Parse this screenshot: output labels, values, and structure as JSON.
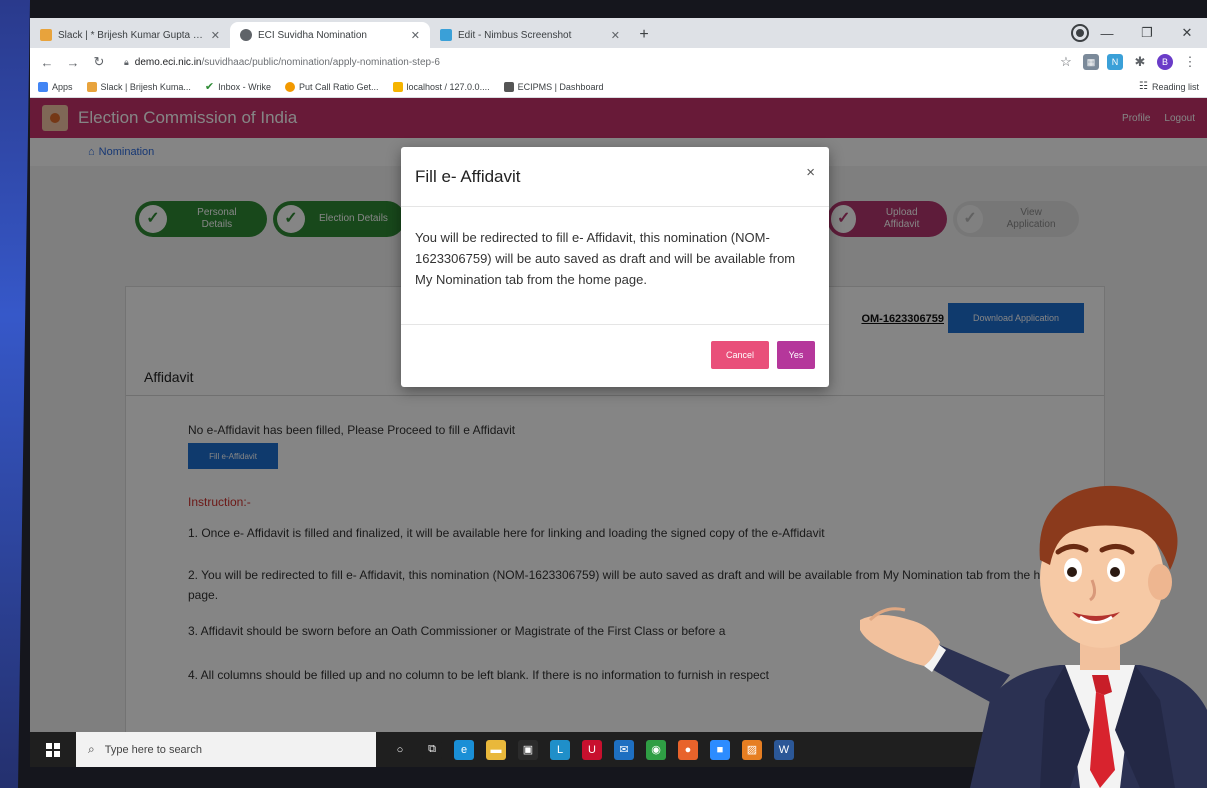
{
  "browser": {
    "tabs": [
      {
        "label": "Slack | * Brijesh Kumar Gupta | ECI",
        "favicon_color": "#e8a33c"
      },
      {
        "label": "ECI Suvidha Nomination",
        "favicon_color": "#5f6368"
      },
      {
        "label": "Edit - Nimbus Screenshot",
        "favicon_color": "#3aa0d8"
      }
    ],
    "new_tab": "+",
    "url_host": "demo.eci.nic.in",
    "url_path": "/suvidhaac/public/nomination/apply-nomination-step-6",
    "bookmarks": [
      {
        "label": "Apps",
        "color": "#4285f4"
      },
      {
        "label": "Slack | Brijesh Kuma...",
        "color": "#e8a33c"
      },
      {
        "label": "Inbox - Wrike",
        "color": "#2e8b34"
      },
      {
        "label": "Put Call Ratio Get...",
        "color": "#f29900"
      },
      {
        "label": "localhost / 127.0.0....",
        "color": "#f5b400"
      },
      {
        "label": "ECIPMS | Dashboard",
        "color": "#555555"
      }
    ],
    "reading_list": "Reading list",
    "profile_initial": "B"
  },
  "app": {
    "title": "Election Commission of India",
    "links": [
      "Profile",
      "Logout"
    ],
    "breadcrumb": "Nomination",
    "steps": [
      {
        "label": "Personal Details",
        "state": "done"
      },
      {
        "label": "Election Details",
        "state": "done"
      },
      {
        "label": "Upload Affidavit",
        "state": "current"
      },
      {
        "label": "View Application",
        "state": "pending"
      }
    ],
    "application_no": "OM-1623306759",
    "download_button": "Download Application",
    "affidavit_heading": "Affidavit",
    "no_affidavit_text": "No e-Affidavit has been filled, Please Proceed to fill e Affidavit",
    "fill_button": "Fill e-Affidavit",
    "instruction_heading": "Instruction:-",
    "instructions": [
      "1. Once e- Affidavit is filled and finalized, it will be available here for linking and loading the signed copy of the e-Affidavit",
      "2. You will be redirected to fill e- Affidavit, this nomination (NOM-1623306759) will be auto saved as draft and will be available from My Nomination tab from the home page.",
      "3. Affidavit should be sworn before an Oath Commissioner or Magistrate of the First Class or before a",
      "4. All columns should be filled up and no column to be left blank. If there is no information to furnish in respect"
    ]
  },
  "modal": {
    "title": "Fill e- Affidavit",
    "close": "×",
    "body": "You will be redirected to fill e- Affidavit, this nomination (NOM-1623306759) will be auto saved as draft and will be available from My Nomination tab from the home page.",
    "cancel": "Cancel",
    "yes": "Yes"
  },
  "taskbar": {
    "search_placeholder": "Type here to search",
    "apps": [
      {
        "icon": "cortana-icon",
        "color": "#1f1f1f",
        "glyph": "○"
      },
      {
        "icon": "task-view-icon",
        "color": "#1f1f1f",
        "glyph": "⧉"
      },
      {
        "icon": "edge-icon",
        "color": "#1a8fd6",
        "glyph": "e"
      },
      {
        "icon": "file-explorer-icon",
        "color": "#e9b83b",
        "glyph": "▬"
      },
      {
        "icon": "store-icon",
        "color": "#2b2b2b",
        "glyph": "▣"
      },
      {
        "icon": "app-l-icon",
        "color": "#1f8fc9",
        "glyph": "L"
      },
      {
        "icon": "mcafee-icon",
        "color": "#c8102e",
        "glyph": "U"
      },
      {
        "icon": "mail-icon",
        "color": "#1e6fc1",
        "glyph": "✉"
      },
      {
        "icon": "chrome-icon",
        "color": "#2f9e44",
        "glyph": "◉"
      },
      {
        "icon": "firefox-icon",
        "color": "#e8632b",
        "glyph": "●"
      },
      {
        "icon": "zoom-icon",
        "color": "#2d8cff",
        "glyph": "■"
      },
      {
        "icon": "photos-icon",
        "color": "#e67e22",
        "glyph": "▨"
      },
      {
        "icon": "word-icon",
        "color": "#2b5797",
        "glyph": "W"
      }
    ]
  }
}
